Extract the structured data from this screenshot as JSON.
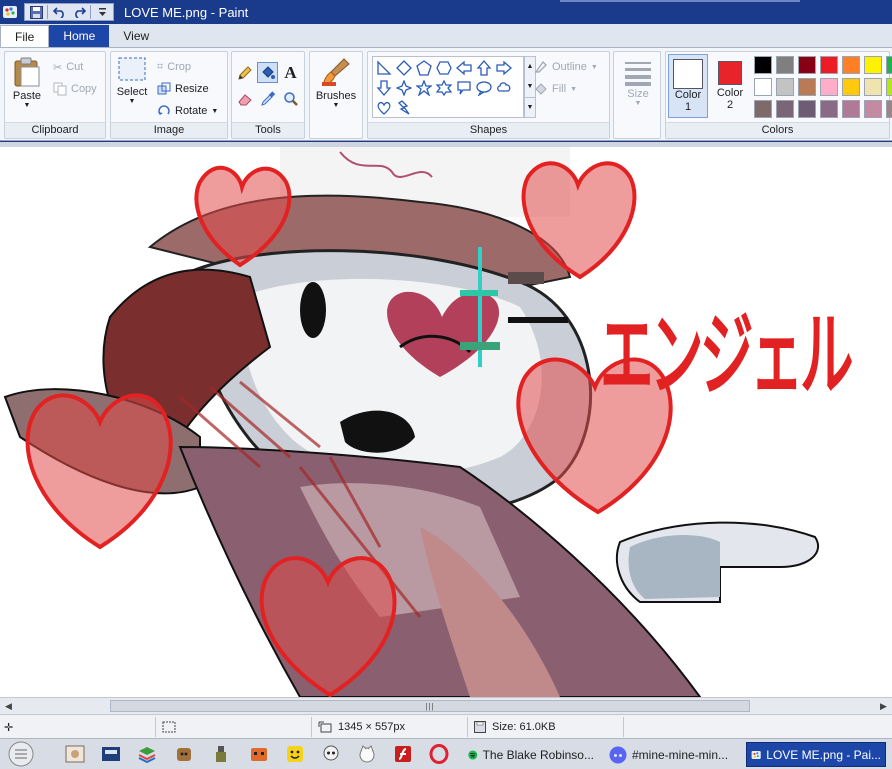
{
  "window": {
    "title": "LOVE ME.png - Paint"
  },
  "tabs": [
    {
      "label": "File"
    },
    {
      "label": "Home"
    },
    {
      "label": "View"
    }
  ],
  "clipboard": {
    "label": "Clipboard",
    "paste": "Paste",
    "cut": "Cut",
    "copy": "Copy"
  },
  "image": {
    "label": "Image",
    "select": "Select",
    "crop": "Crop",
    "resize": "Resize",
    "rotate": "Rotate"
  },
  "tools": {
    "label": "Tools"
  },
  "brushes": {
    "label": "Brushes"
  },
  "shapes": {
    "label": "Shapes",
    "outline": "Outline",
    "fill": "Fill"
  },
  "size": {
    "label": "Size"
  },
  "colors": {
    "label": "Colors",
    "color1": {
      "label": "Color",
      "num": "1",
      "value": "#ffffff"
    },
    "color2": {
      "label": "Color",
      "num": "2",
      "value": "#e8232a"
    },
    "palette": [
      "#000000",
      "#7f7f7f",
      "#880015",
      "#ed1c24",
      "#ff7f27",
      "#fff200",
      "#22b14c",
      "#ffffff",
      "#c3c3c3",
      "#b97a57",
      "#ffaec9",
      "#ffc90e",
      "#efe4b0",
      "#b5e61d",
      "#7f6a6a",
      "#7a6676",
      "#6e5b74",
      "#8a6a84",
      "#b07a97",
      "#c48aa2",
      "#9b8686"
    ]
  },
  "canvas": {
    "art_text": "エンジェル"
  },
  "status": {
    "dimensions": "1345 × 557px",
    "size": "Size: 61.0KB"
  },
  "taskbar": {
    "tasks": [
      {
        "label": "The Blake Robinso..."
      },
      {
        "label": "#mine-mine-min..."
      },
      {
        "label": "LOVE ME.png - Pai..."
      }
    ]
  }
}
